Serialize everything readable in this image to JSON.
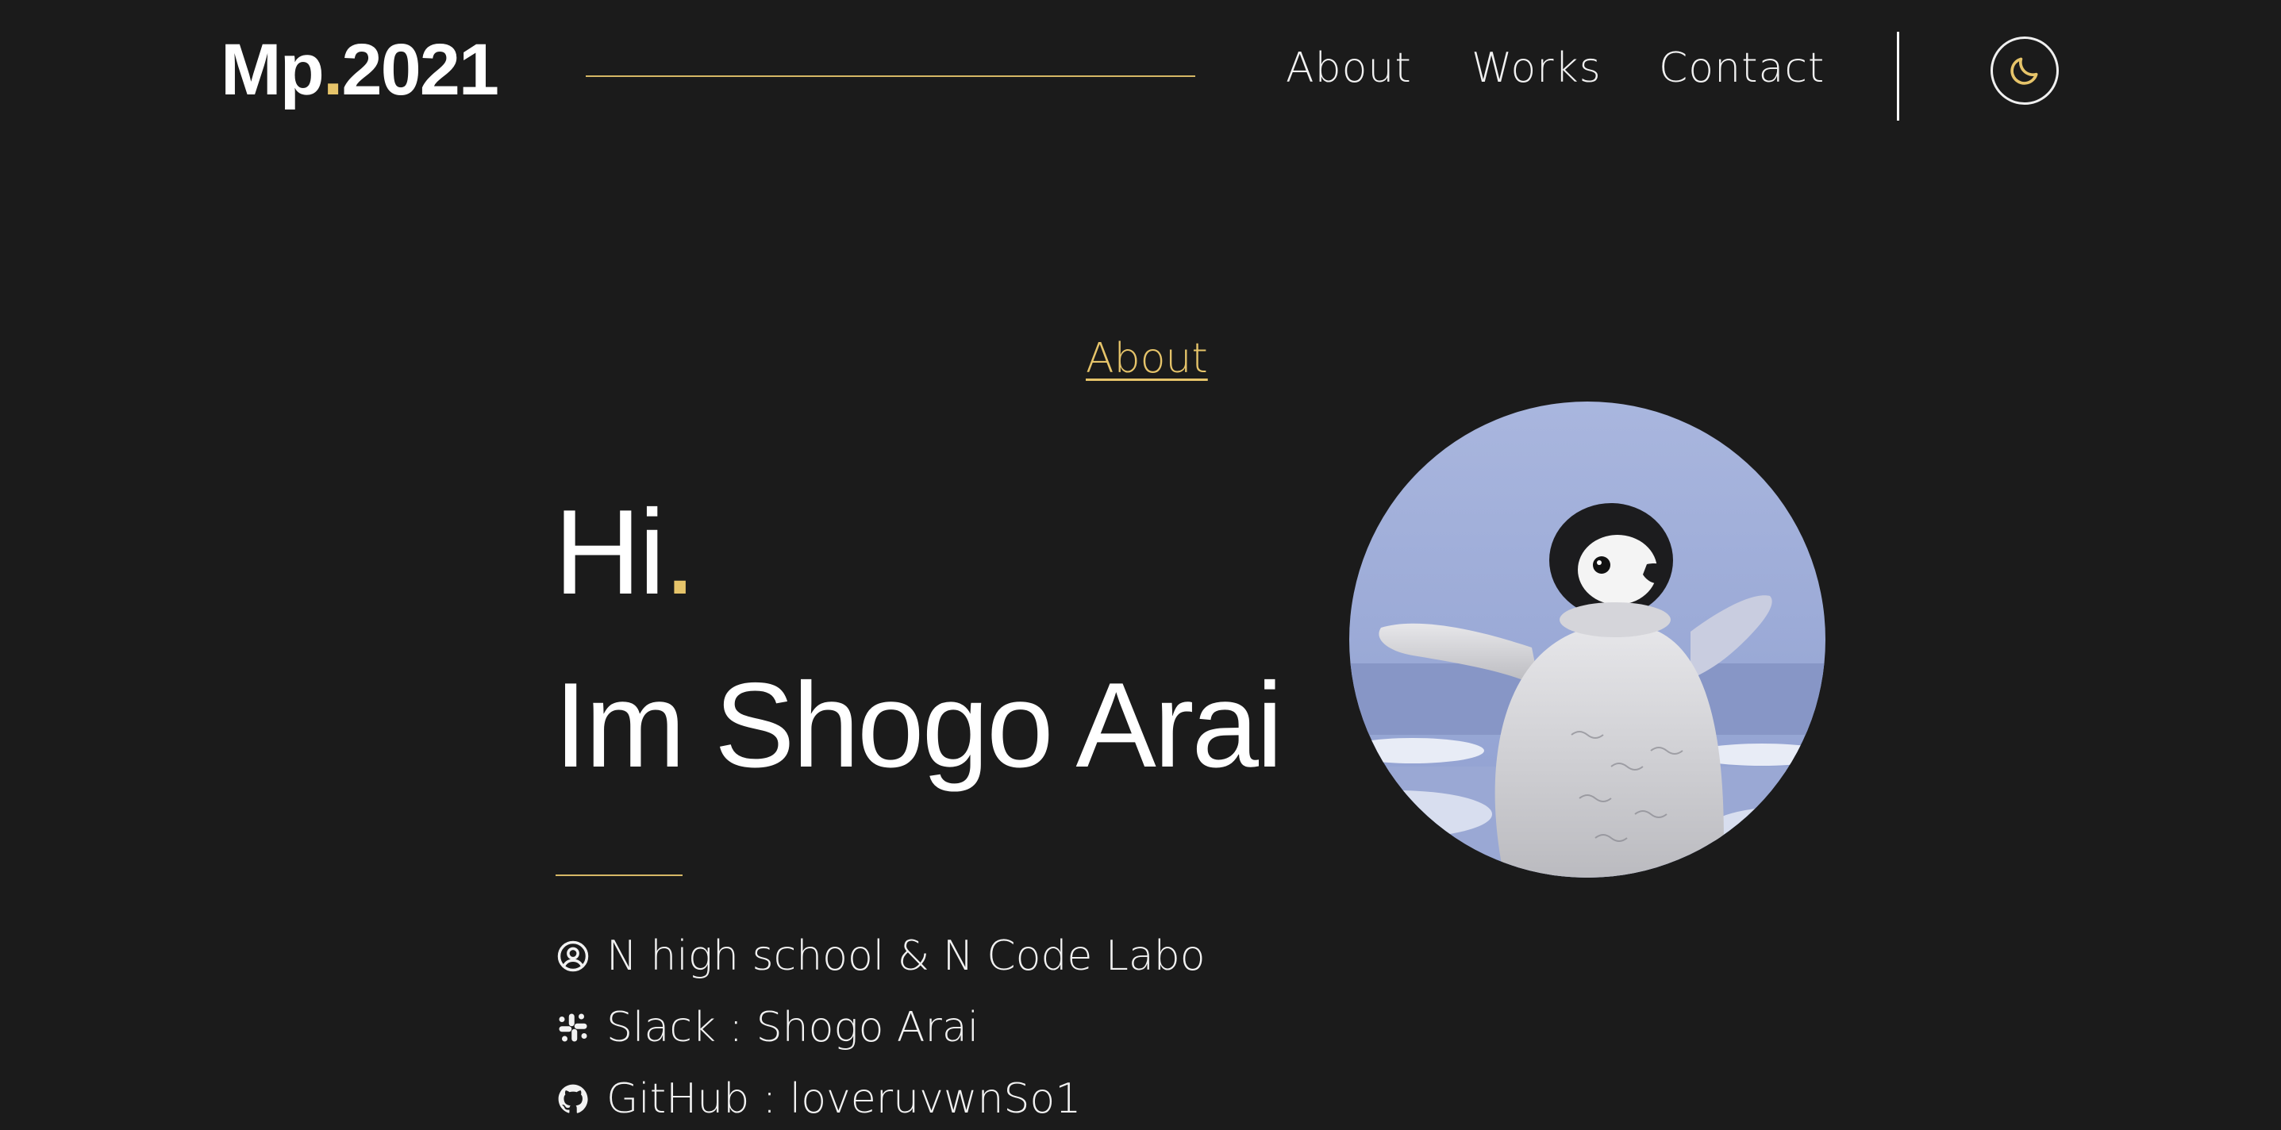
{
  "header": {
    "logo_main": "Mp",
    "logo_dot": ".",
    "logo_year": "2021",
    "nav": [
      {
        "label": "About"
      },
      {
        "label": "Works"
      },
      {
        "label": "Contact"
      }
    ],
    "theme_toggle_icon": "moon-icon"
  },
  "about": {
    "section_label": "About",
    "greeting": "Hi",
    "greeting_dot": ".",
    "name": "Im Shogo Arai",
    "profile_image_icon": "penguin-avatar",
    "info": [
      {
        "icon": "user-circle-icon",
        "text": "N high school & N Code Labo"
      },
      {
        "icon": "slack-icon",
        "text": "Slack : Shogo Arai"
      },
      {
        "icon": "github-icon",
        "text": "GitHub : loveruvwnSo1"
      }
    ]
  },
  "colors": {
    "background": "#1b1b1b",
    "accent": "#e6c46a",
    "text": "#ffffff"
  }
}
